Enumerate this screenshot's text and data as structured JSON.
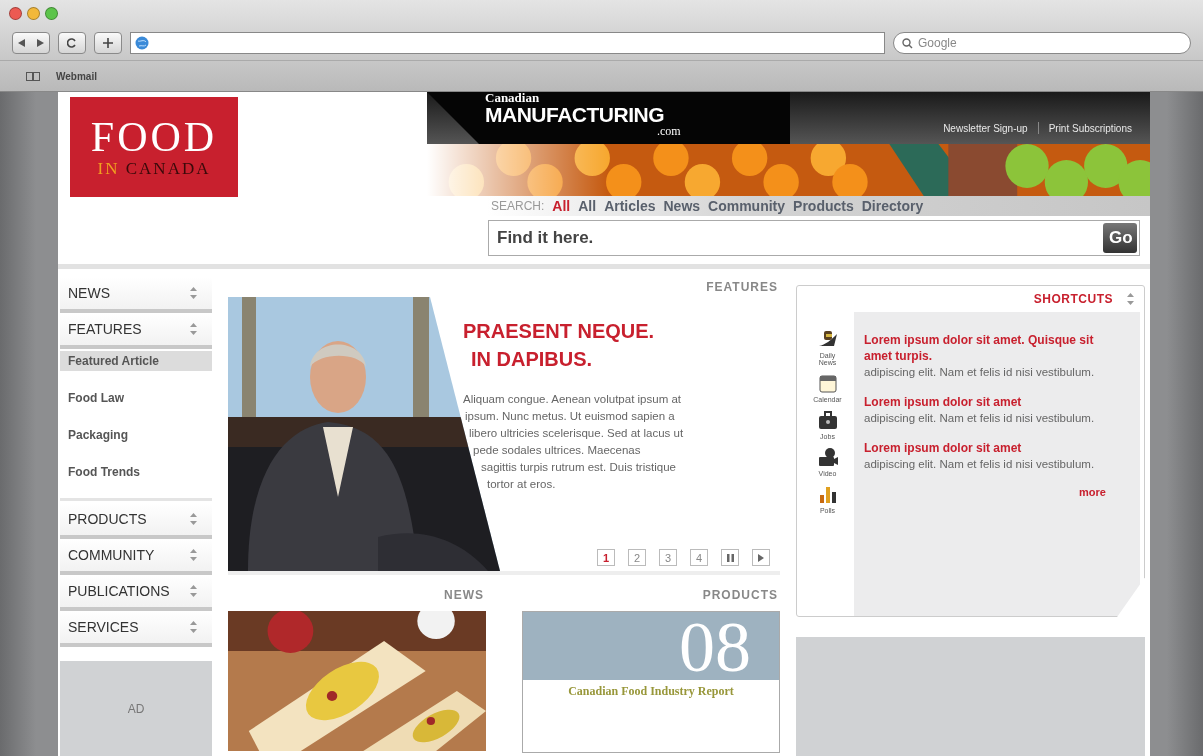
{
  "browser": {
    "search_placeholder": "Google",
    "bookmarks": [
      "Webmail"
    ]
  },
  "header": {
    "logo": {
      "line1": "FOOD",
      "line2a": "IN",
      "line2b": "CANADA"
    },
    "partner_logo": {
      "top": "Canadian",
      "main": "MANUFACTURING",
      "suffix": ".com"
    },
    "links": [
      "Newsletter Sign-up",
      "Print Subscriptions"
    ],
    "search": {
      "label": "SEARCH:",
      "scopes": [
        {
          "label": "All",
          "selected": true
        },
        {
          "label": "All",
          "selected": false
        },
        {
          "label": "Articles",
          "selected": false
        },
        {
          "label": "News",
          "selected": false
        },
        {
          "label": "Community",
          "selected": false
        },
        {
          "label": "Products",
          "selected": false
        },
        {
          "label": "Directory",
          "selected": false
        }
      ],
      "placeholder": "Find it here.",
      "button": "Go"
    }
  },
  "sidebar": {
    "sections": [
      {
        "label": "NEWS"
      },
      {
        "label": "FEATURES",
        "children": [
          {
            "label": "Featured Article",
            "selected": true
          },
          {
            "label": "Food Law",
            "selected": false
          },
          {
            "label": "Packaging",
            "selected": false
          },
          {
            "label": "Food Trends",
            "selected": false
          }
        ]
      },
      {
        "label": "PRODUCTS"
      },
      {
        "label": "COMMUNITY"
      },
      {
        "label": "PUBLICATIONS"
      },
      {
        "label": "SERVICES"
      }
    ],
    "ad": "AD"
  },
  "features": {
    "heading": "FEATURES",
    "title_lines": [
      "PRAESENT NEQUE.",
      "IN DAPIBUS."
    ],
    "body_lines": [
      "Aliquam congue. Aenean volutpat ipsum at",
      "ipsum. Nunc metus. Ut euismod sapien a",
      "libero ultricies scelerisque. Sed at lacus ut",
      "pede sodales ultrices. Maecenas",
      "sagittis turpis rutrum est. Duis tristique",
      "tortor at eros."
    ],
    "pager": [
      {
        "label": "1",
        "selected": true
      },
      {
        "label": "2",
        "selected": false
      },
      {
        "label": "3",
        "selected": false
      },
      {
        "label": "4",
        "selected": false
      }
    ]
  },
  "news": {
    "heading": "NEWS"
  },
  "products": {
    "heading": "PRODUCTS",
    "report_number": "08",
    "report_title": "Canadian Food Industry Report"
  },
  "shortcuts": {
    "heading": "SHORTCUTS",
    "tools": [
      {
        "kind": "news",
        "label": "Daily News"
      },
      {
        "kind": "calendar",
        "label": "Calendar"
      },
      {
        "kind": "jobs",
        "label": "Jobs"
      },
      {
        "kind": "video",
        "label": "Video"
      },
      {
        "kind": "polls",
        "label": "Polls"
      }
    ],
    "items": [
      {
        "title": "Lorem ipsum dolor sit amet. Quisque sit amet turpis.",
        "text": "adipiscing elit. Nam et felis id nisi vestibulum."
      },
      {
        "title": "Lorem ipsum dolor sit amet",
        "text": "adipiscing elit. Nam et felis id nisi vestibulum."
      },
      {
        "title": "Lorem ipsum dolor sit amet",
        "text": "adipiscing elit. Nam et felis id nisi vestibulum."
      }
    ],
    "more": "more"
  }
}
